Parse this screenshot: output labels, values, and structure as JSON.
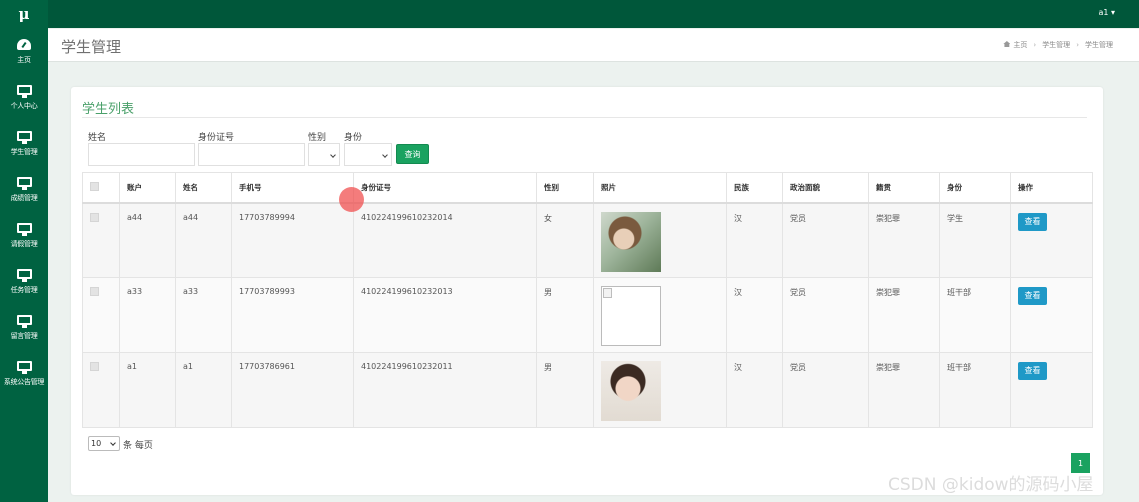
{
  "app": {
    "logo": "μ"
  },
  "topbar": {
    "user": "a1 ▾"
  },
  "sidebar": {
    "items": [
      {
        "label": "主页",
        "icon": "dashboard-icon"
      },
      {
        "label": "个人中心",
        "icon": "monitor-icon"
      },
      {
        "label": "学生管理",
        "icon": "monitor-icon"
      },
      {
        "label": "成绩管理",
        "icon": "monitor-icon"
      },
      {
        "label": "请假管理",
        "icon": "monitor-icon"
      },
      {
        "label": "任务管理",
        "icon": "monitor-icon"
      },
      {
        "label": "留言管理",
        "icon": "monitor-icon"
      },
      {
        "label": "系统公告管理",
        "icon": "monitor-icon"
      }
    ]
  },
  "header": {
    "title": "学生管理",
    "breadcrumb": [
      "主页",
      "学生管理",
      "学生管理"
    ]
  },
  "panel": {
    "title": "学生列表"
  },
  "filters": {
    "name_label": "姓名",
    "idcard_label": "身份证号",
    "gender_label": "性别",
    "role_label": "身份",
    "query_button": "查询"
  },
  "table": {
    "headers": [
      "账户",
      "姓名",
      "手机号",
      "身份证号",
      "性别",
      "照片",
      "民族",
      "政治面貌",
      "籍贯",
      "身份",
      "操作"
    ],
    "rows": [
      {
        "account": "a44",
        "name": "a44",
        "phone": "17703789994",
        "idcard": "410224199610232014",
        "gender": "女",
        "nation": "汉",
        "political": "党员",
        "origin": "崇犯罪",
        "role": "学生",
        "action": "查看"
      },
      {
        "account": "a33",
        "name": "a33",
        "phone": "17703789993",
        "idcard": "410224199610232013",
        "gender": "男",
        "nation": "汉",
        "political": "党员",
        "origin": "崇犯罪",
        "role": "班干部",
        "action": "查看"
      },
      {
        "account": "a1",
        "name": "a1",
        "phone": "17703786961",
        "idcard": "410224199610232011",
        "gender": "男",
        "nation": "汉",
        "political": "党员",
        "origin": "崇犯罪",
        "role": "班干部",
        "action": "查看"
      }
    ]
  },
  "pagination": {
    "page_size": "10",
    "per_page_text": "条 每页",
    "current_page": "1"
  },
  "watermark": "CSDN @kidow的源码小屋",
  "colors": {
    "sidebar": "#006241",
    "topbar": "#00573a",
    "accent": "#1aa260",
    "view_button": "#1f99c7",
    "title": "#4aa06a"
  }
}
